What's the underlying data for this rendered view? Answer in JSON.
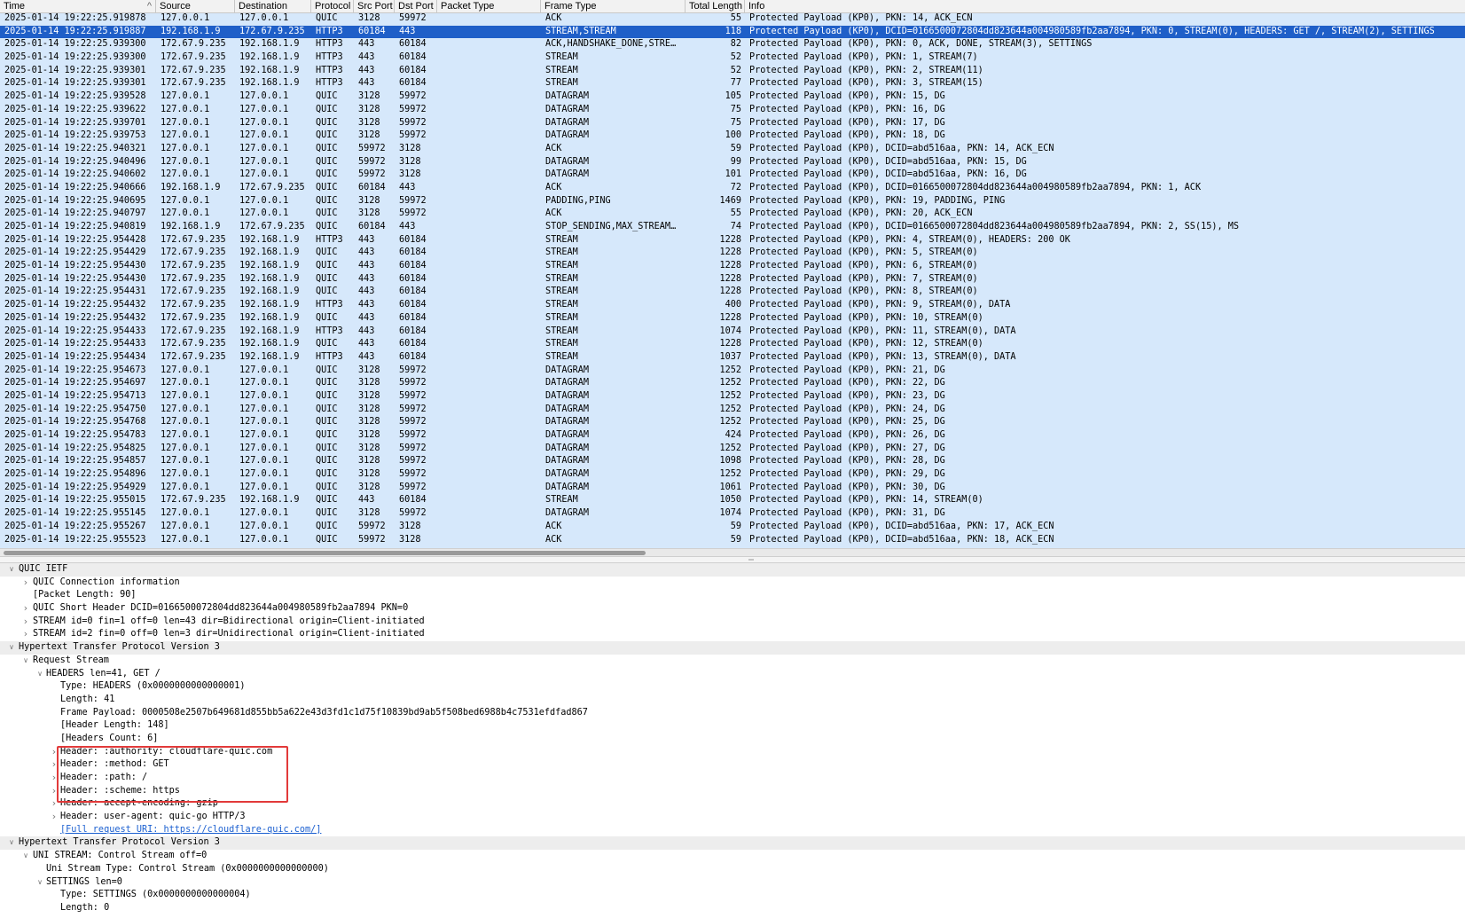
{
  "columns": {
    "time": "Time",
    "source": "Source",
    "destination": "Destination",
    "protocol": "Protocol",
    "src_port": "Src Port",
    "dst_port": "Dst Port",
    "packet_type": "Packet Type",
    "frame_type": "Frame Type",
    "total_length": "Total Length",
    "info": "Info",
    "sort_indicator": "^"
  },
  "packets": [
    [
      "2025-01-14 19:22:25.919878",
      "127.0.0.1",
      "127.0.0.1",
      "QUIC",
      "3128",
      "59972",
      "",
      "ACK",
      "55",
      "Protected Payload (KP0), PKN: 14, ACK_ECN"
    ],
    [
      "2025-01-14 19:22:25.919887",
      "192.168.1.9",
      "172.67.9.235",
      "HTTP3",
      "60184",
      "443",
      "",
      "STREAM,STREAM",
      "118",
      "Protected Payload (KP0), DCID=0166500072804dd823644a004980589fb2aa7894, PKN: 0, STREAM(0), HEADERS: GET /, STREAM(2), SETTINGS"
    ],
    [
      "2025-01-14 19:22:25.939300",
      "172.67.9.235",
      "192.168.1.9",
      "HTTP3",
      "443",
      "60184",
      "",
      "ACK,HANDSHAKE_DONE,STRE…",
      "82",
      "Protected Payload (KP0), PKN: 0, ACK, DONE, STREAM(3), SETTINGS"
    ],
    [
      "2025-01-14 19:22:25.939300",
      "172.67.9.235",
      "192.168.1.9",
      "HTTP3",
      "443",
      "60184",
      "",
      "STREAM",
      "52",
      "Protected Payload (KP0), PKN: 1, STREAM(7)"
    ],
    [
      "2025-01-14 19:22:25.939301",
      "172.67.9.235",
      "192.168.1.9",
      "HTTP3",
      "443",
      "60184",
      "",
      "STREAM",
      "52",
      "Protected Payload (KP0), PKN: 2, STREAM(11)"
    ],
    [
      "2025-01-14 19:22:25.939301",
      "172.67.9.235",
      "192.168.1.9",
      "HTTP3",
      "443",
      "60184",
      "",
      "STREAM",
      "77",
      "Protected Payload (KP0), PKN: 3, STREAM(15)"
    ],
    [
      "2025-01-14 19:22:25.939528",
      "127.0.0.1",
      "127.0.0.1",
      "QUIC",
      "3128",
      "59972",
      "",
      "DATAGRAM",
      "105",
      "Protected Payload (KP0), PKN: 15, DG"
    ],
    [
      "2025-01-14 19:22:25.939622",
      "127.0.0.1",
      "127.0.0.1",
      "QUIC",
      "3128",
      "59972",
      "",
      "DATAGRAM",
      "75",
      "Protected Payload (KP0), PKN: 16, DG"
    ],
    [
      "2025-01-14 19:22:25.939701",
      "127.0.0.1",
      "127.0.0.1",
      "QUIC",
      "3128",
      "59972",
      "",
      "DATAGRAM",
      "75",
      "Protected Payload (KP0), PKN: 17, DG"
    ],
    [
      "2025-01-14 19:22:25.939753",
      "127.0.0.1",
      "127.0.0.1",
      "QUIC",
      "3128",
      "59972",
      "",
      "DATAGRAM",
      "100",
      "Protected Payload (KP0), PKN: 18, DG"
    ],
    [
      "2025-01-14 19:22:25.940321",
      "127.0.0.1",
      "127.0.0.1",
      "QUIC",
      "59972",
      "3128",
      "",
      "ACK",
      "59",
      "Protected Payload (KP0), DCID=abd516aa, PKN: 14, ACK_ECN"
    ],
    [
      "2025-01-14 19:22:25.940496",
      "127.0.0.1",
      "127.0.0.1",
      "QUIC",
      "59972",
      "3128",
      "",
      "DATAGRAM",
      "99",
      "Protected Payload (KP0), DCID=abd516aa, PKN: 15, DG"
    ],
    [
      "2025-01-14 19:22:25.940602",
      "127.0.0.1",
      "127.0.0.1",
      "QUIC",
      "59972",
      "3128",
      "",
      "DATAGRAM",
      "101",
      "Protected Payload (KP0), DCID=abd516aa, PKN: 16, DG"
    ],
    [
      "2025-01-14 19:22:25.940666",
      "192.168.1.9",
      "172.67.9.235",
      "QUIC",
      "60184",
      "443",
      "",
      "ACK",
      "72",
      "Protected Payload (KP0), DCID=0166500072804dd823644a004980589fb2aa7894, PKN: 1, ACK"
    ],
    [
      "2025-01-14 19:22:25.940695",
      "127.0.0.1",
      "127.0.0.1",
      "QUIC",
      "3128",
      "59972",
      "",
      "PADDING,PING",
      "1469",
      "Protected Payload (KP0), PKN: 19, PADDING, PING"
    ],
    [
      "2025-01-14 19:22:25.940797",
      "127.0.0.1",
      "127.0.0.1",
      "QUIC",
      "3128",
      "59972",
      "",
      "ACK",
      "55",
      "Protected Payload (KP0), PKN: 20, ACK_ECN"
    ],
    [
      "2025-01-14 19:22:25.940819",
      "192.168.1.9",
      "172.67.9.235",
      "QUIC",
      "60184",
      "443",
      "",
      "STOP_SENDING,MAX_STREAM…",
      "74",
      "Protected Payload (KP0), DCID=0166500072804dd823644a004980589fb2aa7894, PKN: 2, SS(15), MS"
    ],
    [
      "2025-01-14 19:22:25.954428",
      "172.67.9.235",
      "192.168.1.9",
      "HTTP3",
      "443",
      "60184",
      "",
      "STREAM",
      "1228",
      "Protected Payload (KP0), PKN: 4, STREAM(0), HEADERS: 200 OK"
    ],
    [
      "2025-01-14 19:22:25.954429",
      "172.67.9.235",
      "192.168.1.9",
      "QUIC",
      "443",
      "60184",
      "",
      "STREAM",
      "1228",
      "Protected Payload (KP0), PKN: 5, STREAM(0)"
    ],
    [
      "2025-01-14 19:22:25.954430",
      "172.67.9.235",
      "192.168.1.9",
      "QUIC",
      "443",
      "60184",
      "",
      "STREAM",
      "1228",
      "Protected Payload (KP0), PKN: 6, STREAM(0)"
    ],
    [
      "2025-01-14 19:22:25.954430",
      "172.67.9.235",
      "192.168.1.9",
      "QUIC",
      "443",
      "60184",
      "",
      "STREAM",
      "1228",
      "Protected Payload (KP0), PKN: 7, STREAM(0)"
    ],
    [
      "2025-01-14 19:22:25.954431",
      "172.67.9.235",
      "192.168.1.9",
      "QUIC",
      "443",
      "60184",
      "",
      "STREAM",
      "1228",
      "Protected Payload (KP0), PKN: 8, STREAM(0)"
    ],
    [
      "2025-01-14 19:22:25.954432",
      "172.67.9.235",
      "192.168.1.9",
      "HTTP3",
      "443",
      "60184",
      "",
      "STREAM",
      "400",
      "Protected Payload (KP0), PKN: 9, STREAM(0), DATA"
    ],
    [
      "2025-01-14 19:22:25.954432",
      "172.67.9.235",
      "192.168.1.9",
      "QUIC",
      "443",
      "60184",
      "",
      "STREAM",
      "1228",
      "Protected Payload (KP0), PKN: 10, STREAM(0)"
    ],
    [
      "2025-01-14 19:22:25.954433",
      "172.67.9.235",
      "192.168.1.9",
      "HTTP3",
      "443",
      "60184",
      "",
      "STREAM",
      "1074",
      "Protected Payload (KP0), PKN: 11, STREAM(0), DATA"
    ],
    [
      "2025-01-14 19:22:25.954433",
      "172.67.9.235",
      "192.168.1.9",
      "QUIC",
      "443",
      "60184",
      "",
      "STREAM",
      "1228",
      "Protected Payload (KP0), PKN: 12, STREAM(0)"
    ],
    [
      "2025-01-14 19:22:25.954434",
      "172.67.9.235",
      "192.168.1.9",
      "HTTP3",
      "443",
      "60184",
      "",
      "STREAM",
      "1037",
      "Protected Payload (KP0), PKN: 13, STREAM(0), DATA"
    ],
    [
      "2025-01-14 19:22:25.954673",
      "127.0.0.1",
      "127.0.0.1",
      "QUIC",
      "3128",
      "59972",
      "",
      "DATAGRAM",
      "1252",
      "Protected Payload (KP0), PKN: 21, DG"
    ],
    [
      "2025-01-14 19:22:25.954697",
      "127.0.0.1",
      "127.0.0.1",
      "QUIC",
      "3128",
      "59972",
      "",
      "DATAGRAM",
      "1252",
      "Protected Payload (KP0), PKN: 22, DG"
    ],
    [
      "2025-01-14 19:22:25.954713",
      "127.0.0.1",
      "127.0.0.1",
      "QUIC",
      "3128",
      "59972",
      "",
      "DATAGRAM",
      "1252",
      "Protected Payload (KP0), PKN: 23, DG"
    ],
    [
      "2025-01-14 19:22:25.954750",
      "127.0.0.1",
      "127.0.0.1",
      "QUIC",
      "3128",
      "59972",
      "",
      "DATAGRAM",
      "1252",
      "Protected Payload (KP0), PKN: 24, DG"
    ],
    [
      "2025-01-14 19:22:25.954768",
      "127.0.0.1",
      "127.0.0.1",
      "QUIC",
      "3128",
      "59972",
      "",
      "DATAGRAM",
      "1252",
      "Protected Payload (KP0), PKN: 25, DG"
    ],
    [
      "2025-01-14 19:22:25.954783",
      "127.0.0.1",
      "127.0.0.1",
      "QUIC",
      "3128",
      "59972",
      "",
      "DATAGRAM",
      "424",
      "Protected Payload (KP0), PKN: 26, DG"
    ],
    [
      "2025-01-14 19:22:25.954825",
      "127.0.0.1",
      "127.0.0.1",
      "QUIC",
      "3128",
      "59972",
      "",
      "DATAGRAM",
      "1252",
      "Protected Payload (KP0), PKN: 27, DG"
    ],
    [
      "2025-01-14 19:22:25.954857",
      "127.0.0.1",
      "127.0.0.1",
      "QUIC",
      "3128",
      "59972",
      "",
      "DATAGRAM",
      "1098",
      "Protected Payload (KP0), PKN: 28, DG"
    ],
    [
      "2025-01-14 19:22:25.954896",
      "127.0.0.1",
      "127.0.0.1",
      "QUIC",
      "3128",
      "59972",
      "",
      "DATAGRAM",
      "1252",
      "Protected Payload (KP0), PKN: 29, DG"
    ],
    [
      "2025-01-14 19:22:25.954929",
      "127.0.0.1",
      "127.0.0.1",
      "QUIC",
      "3128",
      "59972",
      "",
      "DATAGRAM",
      "1061",
      "Protected Payload (KP0), PKN: 30, DG"
    ],
    [
      "2025-01-14 19:22:25.955015",
      "172.67.9.235",
      "192.168.1.9",
      "QUIC",
      "443",
      "60184",
      "",
      "STREAM",
      "1050",
      "Protected Payload (KP0), PKN: 14, STREAM(0)"
    ],
    [
      "2025-01-14 19:22:25.955145",
      "127.0.0.1",
      "127.0.0.1",
      "QUIC",
      "3128",
      "59972",
      "",
      "DATAGRAM",
      "1074",
      "Protected Payload (KP0), PKN: 31, DG"
    ],
    [
      "2025-01-14 19:22:25.955267",
      "127.0.0.1",
      "127.0.0.1",
      "QUIC",
      "59972",
      "3128",
      "",
      "ACK",
      "59",
      "Protected Payload (KP0), DCID=abd516aa, PKN: 17, ACK_ECN"
    ],
    [
      "2025-01-14 19:22:25.955523",
      "127.0.0.1",
      "127.0.0.1",
      "QUIC",
      "59972",
      "3128",
      "",
      "ACK",
      "59",
      "Protected Payload (KP0), DCID=abd516aa, PKN: 18, ACK_ECN"
    ]
  ],
  "selected_packet_index": 1,
  "details": [
    {
      "level": 0,
      "arrow": "expanded",
      "section": true,
      "text": "QUIC IETF"
    },
    {
      "level": 1,
      "arrow": "collapsed",
      "text": "QUIC Connection information"
    },
    {
      "level": 1,
      "arrow": "none",
      "text": "[Packet Length: 90]"
    },
    {
      "level": 1,
      "arrow": "collapsed",
      "text": "QUIC Short Header DCID=0166500072804dd823644a004980589fb2aa7894 PKN=0"
    },
    {
      "level": 1,
      "arrow": "collapsed",
      "text": "STREAM id=0 fin=1 off=0 len=43 dir=Bidirectional origin=Client-initiated"
    },
    {
      "level": 1,
      "arrow": "collapsed",
      "text": "STREAM id=2 fin=0 off=0 len=3 dir=Unidirectional origin=Client-initiated"
    },
    {
      "level": 0,
      "arrow": "expanded",
      "section": true,
      "text": "Hypertext Transfer Protocol Version 3"
    },
    {
      "level": 1,
      "arrow": "expanded",
      "text": "Request Stream"
    },
    {
      "level": 2,
      "arrow": "expanded",
      "text": "HEADERS len=41, GET /"
    },
    {
      "level": 3,
      "arrow": "none",
      "text": "Type: HEADERS (0x0000000000000001)"
    },
    {
      "level": 3,
      "arrow": "none",
      "text": "Length: 41"
    },
    {
      "level": 3,
      "arrow": "none",
      "text": "Frame Payload: 0000508e2507b649681d855bb5a622e43d3fd1c1d75f10839bd9ab5f508bed6988b4c7531efdfad867"
    },
    {
      "level": 3,
      "arrow": "none",
      "text": "[Header Length: 148]"
    },
    {
      "level": 3,
      "arrow": "none",
      "text": "[Headers Count: 6]"
    },
    {
      "level": 3,
      "arrow": "collapsed",
      "text": "Header: :authority: cloudflare-quic.com"
    },
    {
      "level": 3,
      "arrow": "collapsed",
      "text": "Header: :method: GET"
    },
    {
      "level": 3,
      "arrow": "collapsed",
      "text": "Header: :path: /"
    },
    {
      "level": 3,
      "arrow": "collapsed",
      "text": "Header: :scheme: https"
    },
    {
      "level": 3,
      "arrow": "collapsed",
      "text": "Header: accept-encoding: gzip"
    },
    {
      "level": 3,
      "arrow": "collapsed",
      "text": "Header: user-agent: quic-go HTTP/3"
    },
    {
      "level": 3,
      "arrow": "none",
      "link": true,
      "text": "[Full request URI: https://cloudflare-quic.com/]"
    },
    {
      "level": 0,
      "arrow": "expanded",
      "section": true,
      "text": "Hypertext Transfer Protocol Version 3"
    },
    {
      "level": 1,
      "arrow": "expanded",
      "text": "UNI STREAM: Control Stream off=0"
    },
    {
      "level": 2,
      "arrow": "none",
      "text": "Uni Stream Type: Control Stream (0x0000000000000000)"
    },
    {
      "level": 2,
      "arrow": "expanded",
      "text": "SETTINGS len=0"
    },
    {
      "level": 3,
      "arrow": "none",
      "text": "Type: SETTINGS (0x0000000000000004)"
    },
    {
      "level": 3,
      "arrow": "none",
      "text": "Length: 0"
    }
  ],
  "colors": {
    "list_background": "#d6e8fb",
    "selected_row": "#1f5fc8",
    "highlight_box": "#e23a3a",
    "link": "#1a5fd0"
  }
}
